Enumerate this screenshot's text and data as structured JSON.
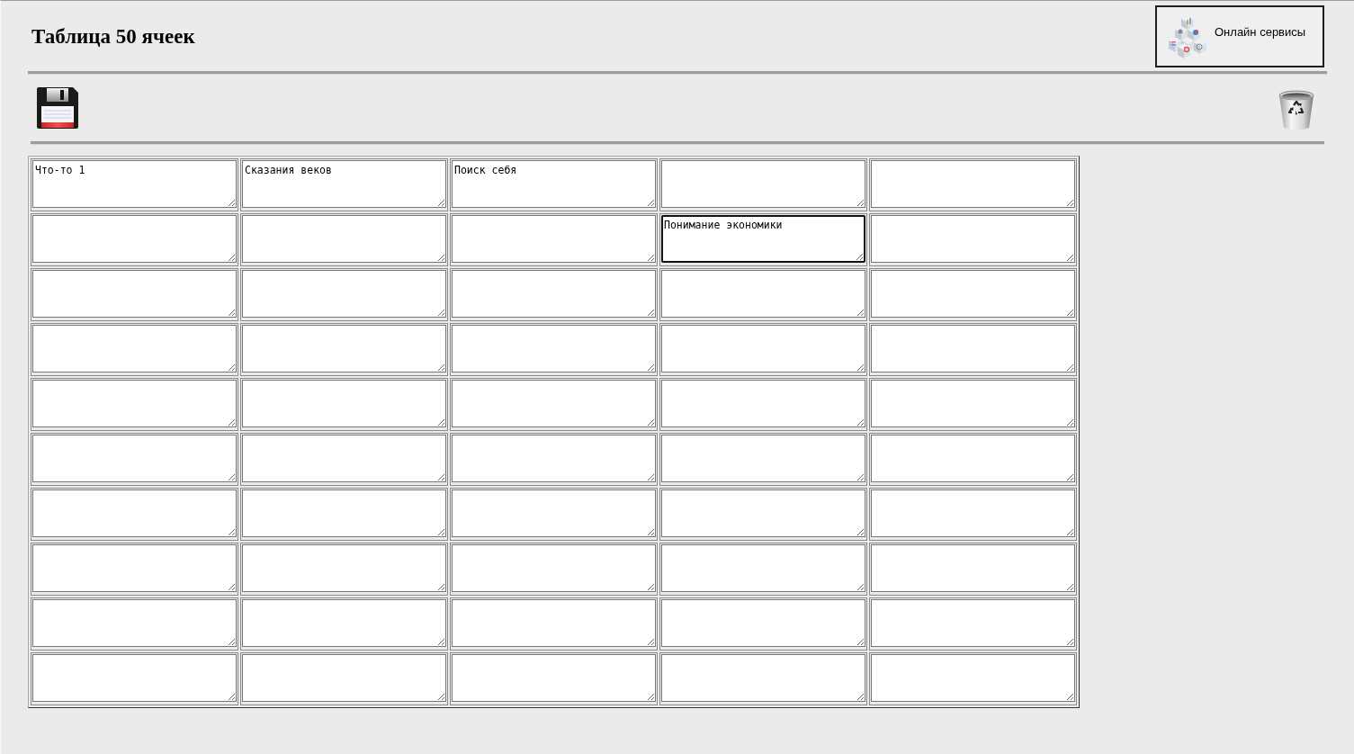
{
  "header": {
    "title": "Таблица 50 ячеек",
    "services_button": {
      "label": "Онлайн сервисы"
    }
  },
  "table": {
    "rows": [
      {
        "cells": [
          {
            "value": "Что-то 1",
            "focused": false
          },
          {
            "value": "Сказания веков",
            "focused": false
          },
          {
            "value": "Поиск себя",
            "focused": false
          },
          {
            "focused": false
          },
          {
            "focused": false
          }
        ]
      },
      {
        "cells": [
          {
            "focused": false
          },
          {
            "focused": false
          },
          {
            "focused": false
          },
          {
            "value": "Понимание экономики",
            "focused": true
          },
          {
            "focused": false
          }
        ]
      },
      {
        "cells": [
          {
            "focused": false
          },
          {
            "focused": false
          },
          {
            "focused": false
          },
          {
            "focused": false
          },
          {
            "focused": false
          }
        ]
      },
      {
        "cells": [
          {
            "focused": false
          },
          {
            "focused": false
          },
          {
            "focused": false
          },
          {
            "focused": false
          },
          {
            "focused": false
          }
        ]
      },
      {
        "cells": [
          {
            "focused": false
          },
          {
            "focused": false
          },
          {
            "focused": false
          },
          {
            "focused": false
          },
          {
            "focused": false
          }
        ]
      },
      {
        "cells": [
          {
            "focused": false
          },
          {
            "focused": false
          },
          {
            "focused": false
          },
          {
            "focused": false
          },
          {
            "focused": false
          }
        ]
      },
      {
        "cells": [
          {
            "focused": false
          },
          {
            "focused": false
          },
          {
            "focused": false
          },
          {
            "focused": false
          },
          {
            "focused": false
          }
        ]
      },
      {
        "cells": [
          {
            "focused": false
          },
          {
            "focused": false
          },
          {
            "focused": false
          },
          {
            "focused": false
          },
          {
            "focused": false
          }
        ]
      },
      {
        "cells": [
          {
            "focused": false
          },
          {
            "focused": false
          },
          {
            "focused": false
          },
          {
            "focused": false
          },
          {
            "focused": false
          }
        ]
      },
      {
        "cells": [
          {
            "focused": false
          },
          {
            "focused": false
          },
          {
            "focused": false
          },
          {
            "focused": false
          },
          {
            "focused": false
          }
        ]
      }
    ]
  }
}
